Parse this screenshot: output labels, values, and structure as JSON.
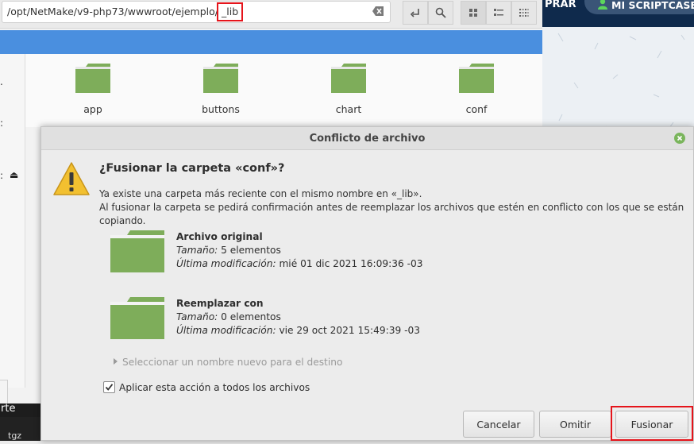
{
  "file_manager": {
    "path_prefix": "/opt/NetMake/v9-php73/wwwroot/ejemplo/",
    "path_current": "_lib",
    "folders": [
      "app",
      "buttons",
      "chart",
      "conf"
    ],
    "sidebar_marks": [
      ".",
      ":",
      ":"
    ],
    "eject_glyph": "⏏"
  },
  "site": {
    "menu_partial": "PRAR",
    "account_button": "MI SCRIPTCASE"
  },
  "background_text": {
    "partial_label": "rte",
    "file_name": "tgz"
  },
  "dialog": {
    "title": "Conflicto de archivo",
    "heading": "¿Fusionar la carpeta «conf»?",
    "message_line1": "Ya existe una carpeta más reciente con el mismo nombre en «_lib».",
    "message_line2": "Al fusionar la carpeta se pedirá confirmación antes de reemplazar los archivos que estén en conflicto con los que se están copiando.",
    "original": {
      "title": "Archivo original",
      "size_label": "Tamaño:",
      "size_value": "5 elementos",
      "modified_label": "Última modificación:",
      "modified_value": "mié 01 dic 2021 16:09:36 -03"
    },
    "replace": {
      "title": "Reemplazar con",
      "size_label": "Tamaño:",
      "size_value": "0 elementos",
      "modified_label": "Última modificación:",
      "modified_value": "vie 29 oct 2021 15:49:39 -03"
    },
    "rename_expander": "Seleccionar un nombre nuevo para el destino",
    "apply_all_label": "Aplicar esta acción a todos los archivos",
    "apply_all_checked": true,
    "buttons": {
      "cancel": "Cancelar",
      "skip": "Omitir",
      "merge": "Fusionar"
    }
  },
  "colors": {
    "folder_green": "#7ead5a",
    "highlight_red": "#e5141b",
    "title_blue": "#4a8fdf",
    "site_navy": "#0f2a4c"
  }
}
